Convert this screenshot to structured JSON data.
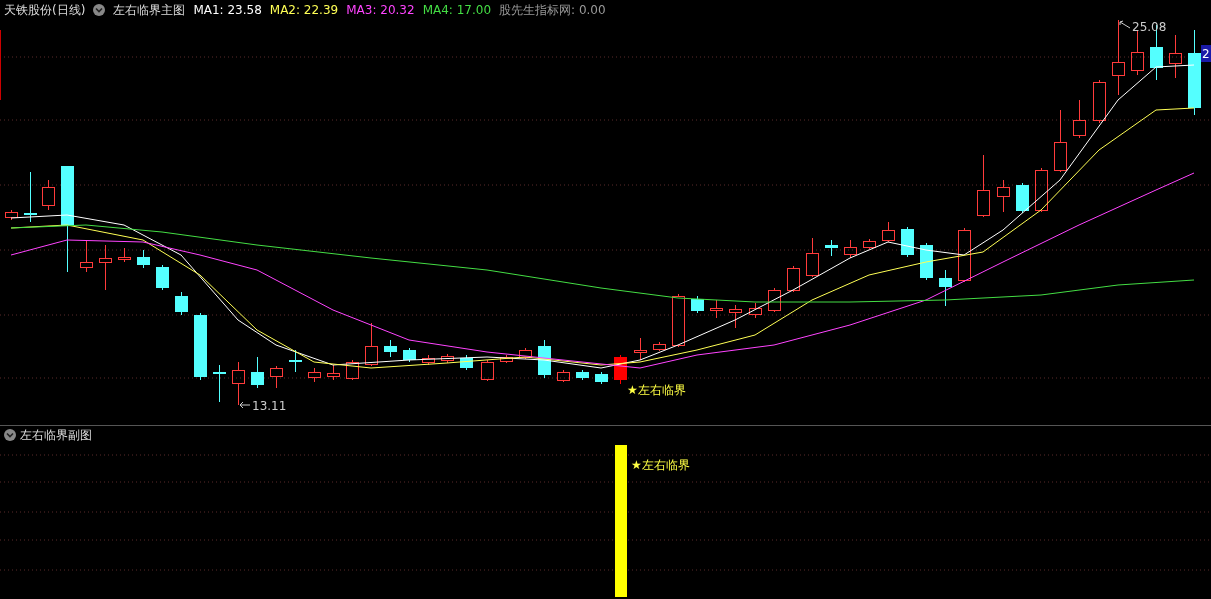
{
  "header": {
    "title": "天铁股份(日线)",
    "indicator": "左右临界主图",
    "moving_averages": [
      {
        "label": "MA1:",
        "value": "23.58",
        "color": "#ffffff"
      },
      {
        "label": "MA2:",
        "value": "22.39",
        "color": "#ffff55"
      },
      {
        "label": "MA3:",
        "value": "20.32",
        "color": "#ff44ff"
      },
      {
        "label": "MA4:",
        "value": "17.00",
        "color": "#44dd44"
      }
    ],
    "source": {
      "label": "股先生指标网:",
      "value": "0.00"
    }
  },
  "main_chart": {
    "high_label": "25.08",
    "low_label": "13.11",
    "signal_label": "★左右临界",
    "price_tag": "2"
  },
  "sub_chart": {
    "title": "左右临界副图",
    "signal_label": "★左右临界"
  }
}
